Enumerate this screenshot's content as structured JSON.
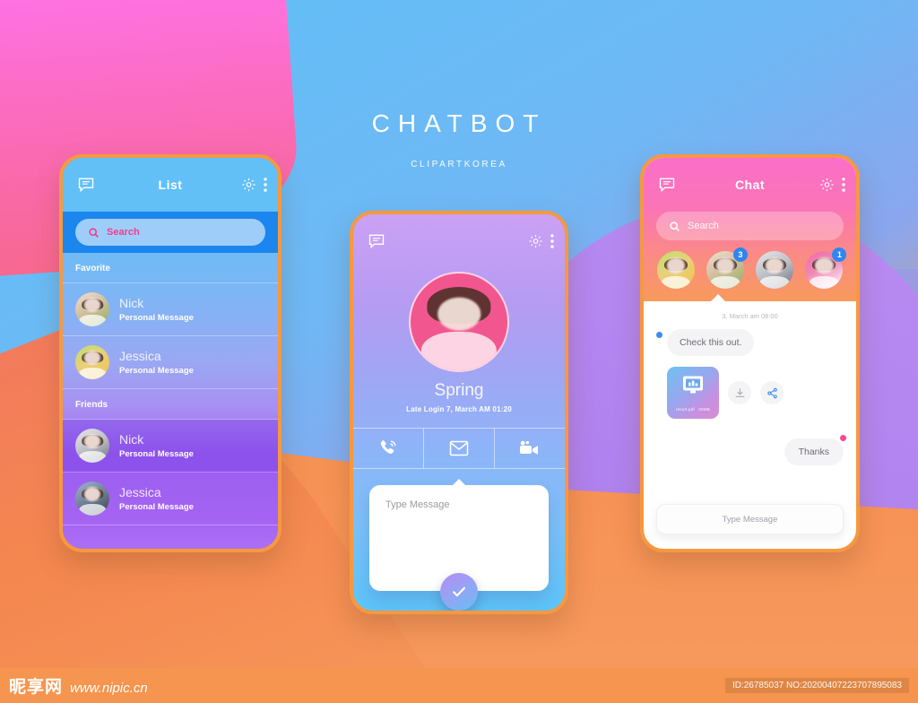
{
  "heading": {
    "title": "CHATBOT",
    "subtitle": "CLIPARTKOREA"
  },
  "colors": {
    "phone_border": "#f7983f",
    "accent_pink": "#ec3f8e",
    "badge_blue": "#2f86f0",
    "dot_pink": "#f8478f"
  },
  "phone_list": {
    "bar_title": "List",
    "icons": {
      "message": "message-icon",
      "gear": "gear-icon",
      "more": "more-vertical-icon"
    },
    "search": {
      "placeholder": "Search",
      "icon": "search-icon"
    },
    "sections": [
      {
        "label": "Favorite",
        "rows": [
          {
            "name": "Nick",
            "sub": "Personal Message"
          },
          {
            "name": "Jessica",
            "sub": "Personal Message"
          }
        ]
      },
      {
        "label": "Friends",
        "rows": [
          {
            "name": "Nick",
            "sub": "Personal Message"
          },
          {
            "name": "Jessica",
            "sub": "Personal Message"
          }
        ]
      }
    ]
  },
  "phone_profile": {
    "icons": {
      "message": "message-icon",
      "gear": "gear-icon",
      "more": "more-vertical-icon"
    },
    "profile": {
      "name": "Spring",
      "status": "Late Login  7, March AM 01:20",
      "avatar": "profile-avatar"
    },
    "actions": [
      {
        "name": "call-action",
        "icon": "phone-icon"
      },
      {
        "name": "mail-action",
        "icon": "envelope-icon"
      },
      {
        "name": "video-action",
        "icon": "video-camera-icon"
      }
    ],
    "compose": {
      "placeholder": "Type Message",
      "send_icon": "check-icon"
    }
  },
  "phone_chat": {
    "bar_title": "Chat",
    "icons": {
      "message": "message-icon",
      "gear": "gear-icon",
      "more": "more-vertical-icon"
    },
    "search": {
      "placeholder": "Search",
      "icon": "search-icon"
    },
    "stories": [
      {
        "name": "story-1",
        "badge": ""
      },
      {
        "name": "story-2",
        "badge": "3"
      },
      {
        "name": "story-3",
        "badge": ""
      },
      {
        "name": "story-4",
        "badge": "1"
      }
    ],
    "timestamp": "3, March  am 08:00",
    "messages": [
      {
        "side": "in",
        "text": "Check this out."
      },
      {
        "side": "out",
        "text": "Thanks"
      }
    ],
    "attachment": {
      "filename": "result.pdf",
      "size": "20MB",
      "icon": "chart-monitor-icon",
      "download_icon": "download-icon",
      "share_icon": "share-icon"
    },
    "input": {
      "placeholder": "Type Message"
    }
  },
  "footer": {
    "brand_cn": "昵享网",
    "brand_url": "www.nipic.cn",
    "idcode": "ID:26785037 NO:20200407223707895083"
  }
}
